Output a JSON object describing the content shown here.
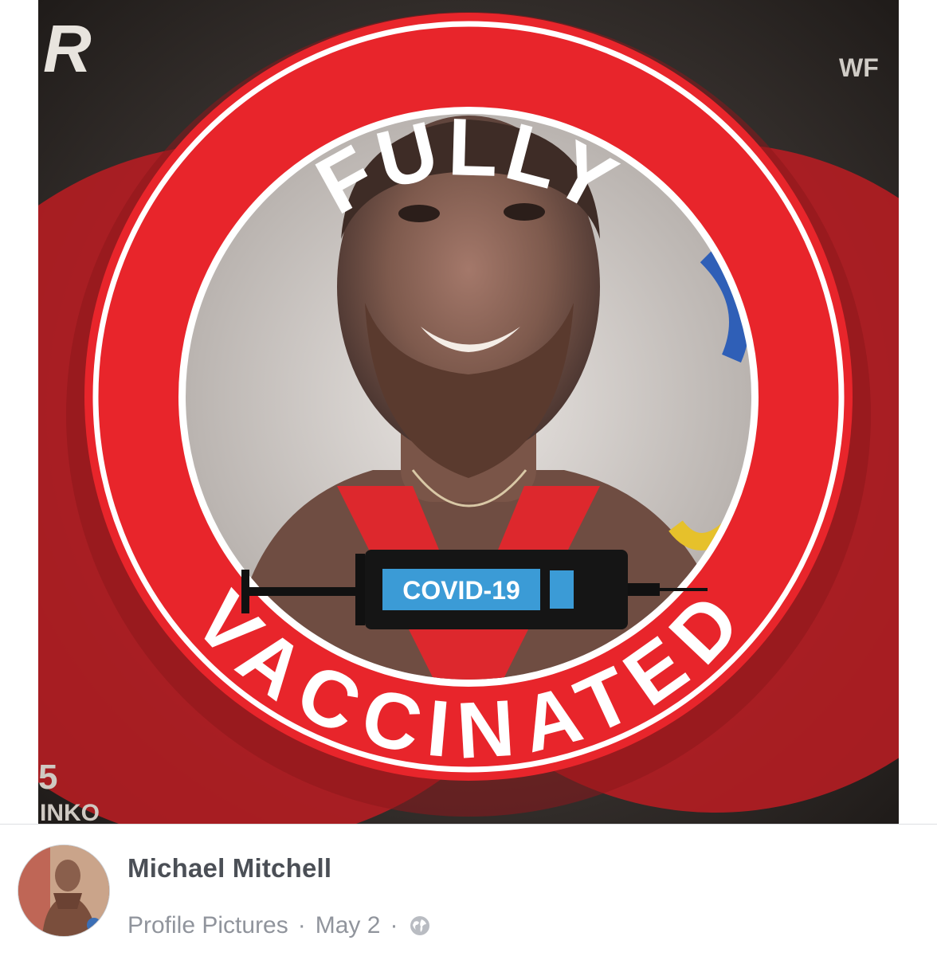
{
  "image": {
    "banner_top": "FULLY",
    "banner_bottom": "VACCINATED",
    "syringe_label": "COVID-19",
    "background_fragments": [
      "R",
      "WF",
      "INKO",
      "5"
    ],
    "colors": {
      "ring": "#e8252b",
      "ring_text": "#ffffff",
      "syringe_label_bg": "#3b9bd6"
    }
  },
  "post": {
    "author": "Michael Mitchell",
    "album": "Profile Pictures",
    "separator": "·",
    "date": "May 2",
    "privacy_icon": "globe-icon"
  }
}
